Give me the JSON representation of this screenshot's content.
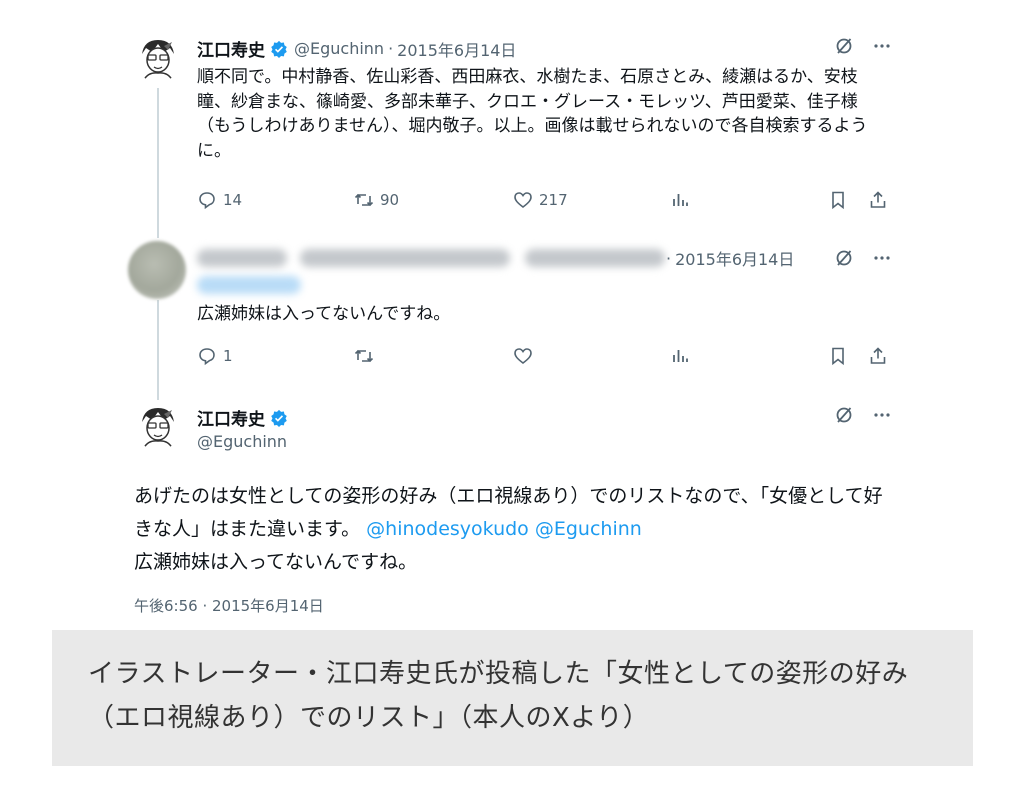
{
  "tweet1": {
    "name": "江口寿史",
    "handle": "@Eguchinn",
    "date": "2015年6月14日",
    "text": "順不同で。中村静香、佐山彩香、西田麻衣、水樹たま、石原さとみ、綾瀬はるか、安枝瞳、紗倉まな、篠崎愛、多部未華子、クロエ・グレース・モレッツ、芦田愛菜、佳子様（もうしわけありません）、堀内敬子。以上。画像は載せられないので各自検索するように。",
    "replies": "14",
    "retweets": "90",
    "likes": "217"
  },
  "tweet2": {
    "date": "2015年6月14日",
    "text": "広瀬姉妹は入ってないんですね。",
    "replies": "1"
  },
  "tweet3": {
    "name": "江口寿史",
    "handle": "@Eguchinn",
    "text_before": "あげたのは女性としての姿形の好み（エロ視線あり）でのリストなので、「女優として好きな人」はまた違います。",
    "mention1": "@hinodesyokudo",
    "mention2": "@Eguchinn",
    "text_after": "広瀬姉妹は入ってないんですね。",
    "timestamp": "午後6:56 · 2015年6月14日"
  },
  "caption": "イラストレーター・江口寿史氏が投稿した「女性としての姿形の好み（エロ視線あり）でのリスト」（本人のXより）",
  "colors": {
    "text": "#0f1419",
    "muted": "#536471",
    "accent": "#1d9bf0",
    "caption_bg": "#e9e9e9"
  }
}
